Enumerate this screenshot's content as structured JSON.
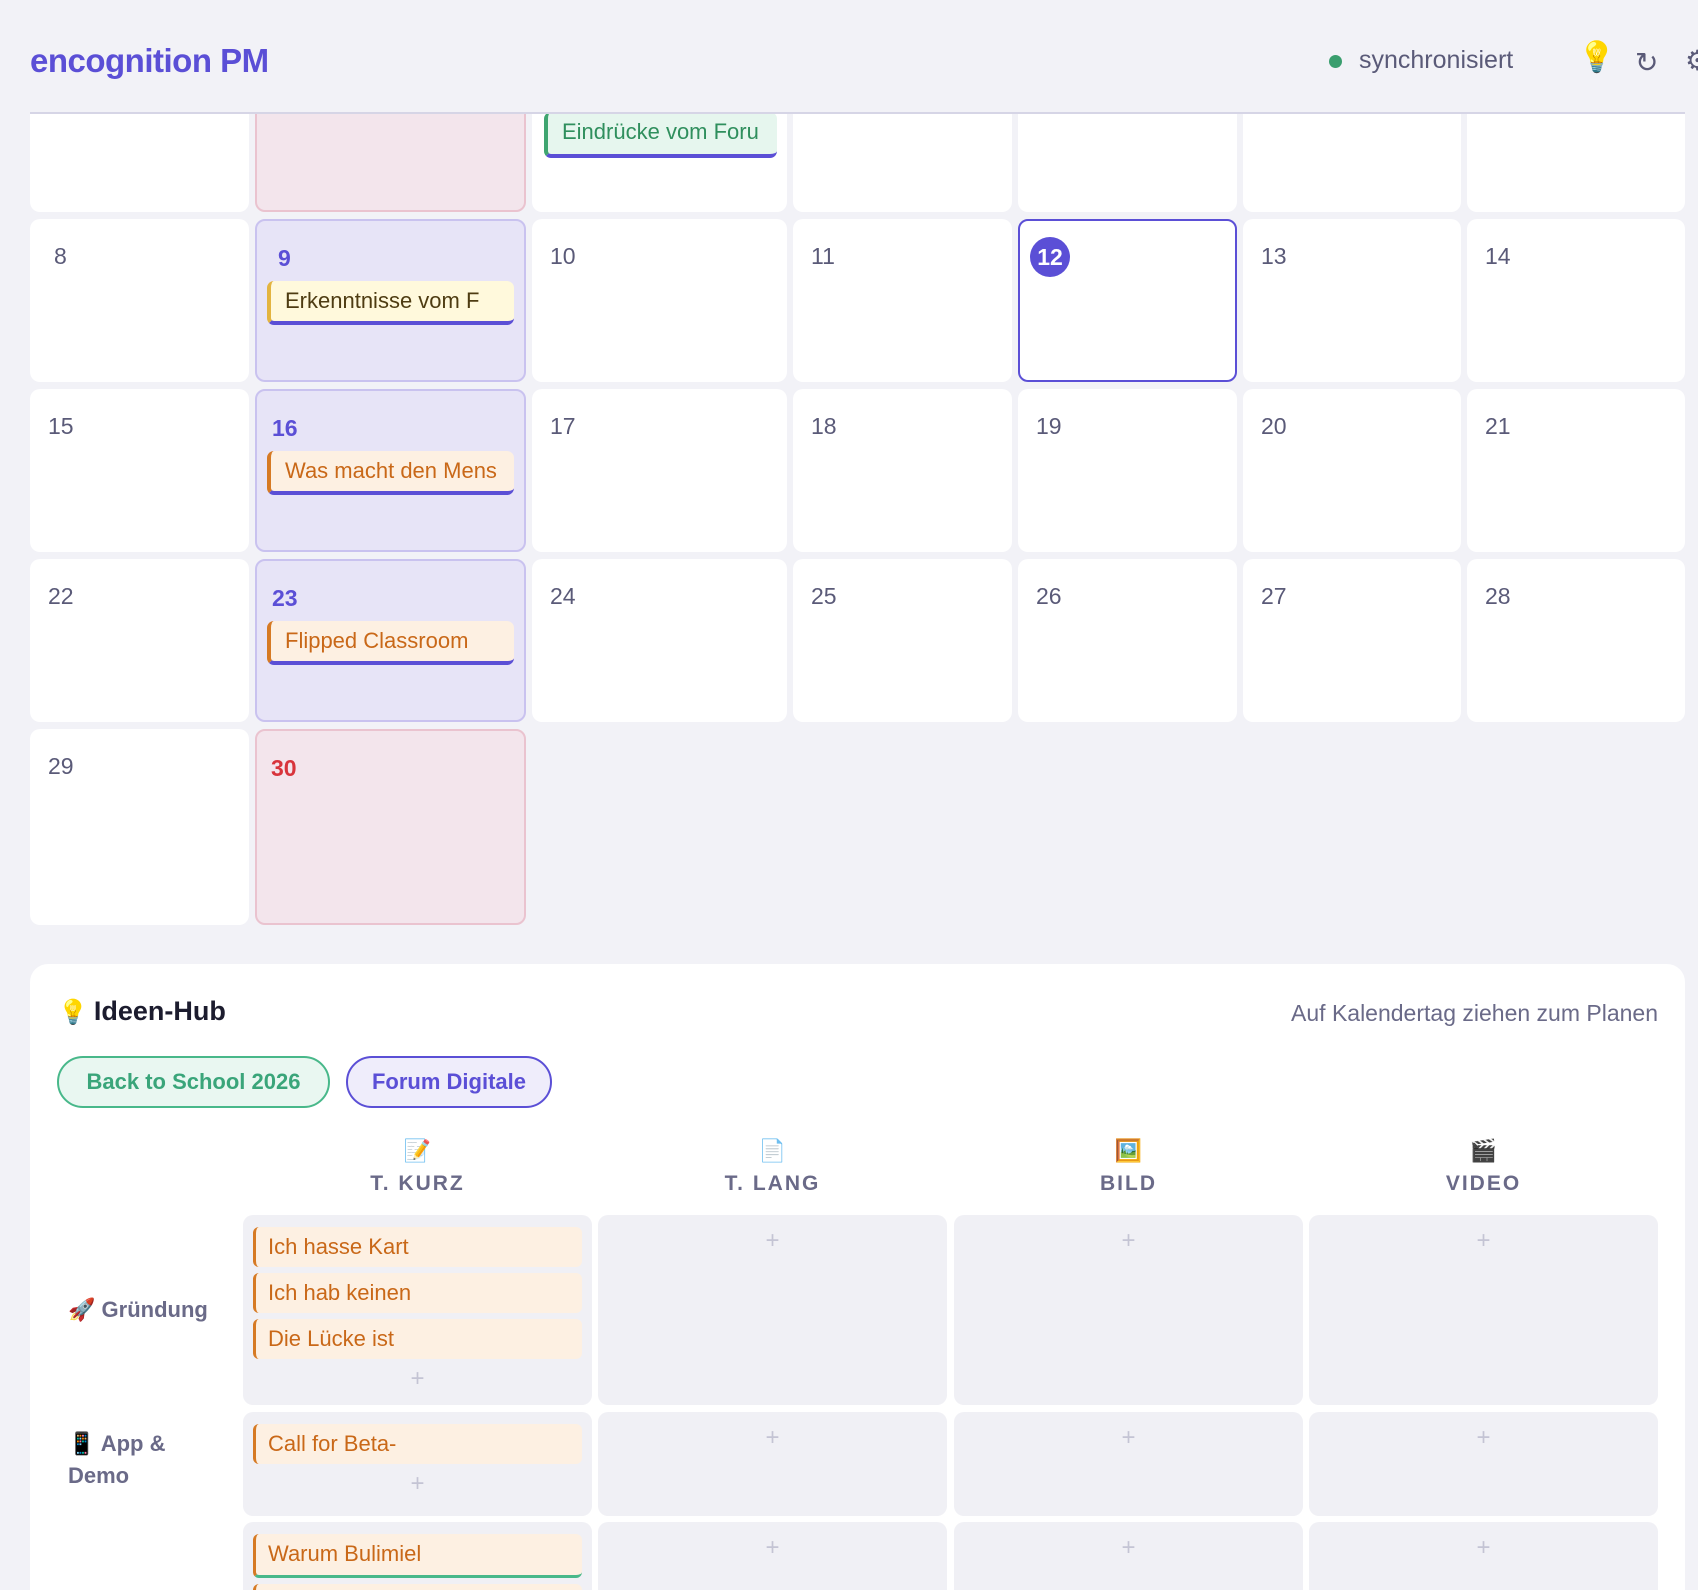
{
  "header": {
    "brand": "encognition PM",
    "sync_status": "synchronisiert",
    "icons": [
      "lightbulb-icon",
      "refresh-icon",
      "gear-icon"
    ]
  },
  "calendar": {
    "top_partial_event": "Eindrücke vom Foru",
    "days": {
      "d8": "8",
      "d9": "9",
      "d10": "10",
      "d11": "11",
      "d12": "12",
      "d13": "13",
      "d14": "14",
      "d15": "15",
      "d16": "16",
      "d17": "17",
      "d18": "18",
      "d19": "19",
      "d20": "20",
      "d21": "21",
      "d22": "22",
      "d23": "23",
      "d24": "24",
      "d25": "25",
      "d26": "26",
      "d27": "27",
      "d28": "28",
      "d29": "29",
      "d30": "30"
    },
    "events": {
      "d9": "Erkenntnisse vom F",
      "d16": "Was macht den Mens",
      "d23": "Flipped Classroom"
    }
  },
  "hub": {
    "title": "Ideen-Hub",
    "hint": "Auf Kalendertag ziehen zum Planen",
    "pills": [
      "Back to School 2026",
      "Forum Digitale"
    ],
    "columns": [
      {
        "icon": "📝",
        "label": "T. KURZ"
      },
      {
        "icon": "📄",
        "label": "T. LANG"
      },
      {
        "icon": "🖼️",
        "label": "BILD"
      },
      {
        "icon": "🎬",
        "label": "VIDEO"
      }
    ],
    "rows": [
      {
        "icon": "🚀",
        "label": "Gründung",
        "cards": [
          "Ich hasse Kart",
          "Ich hab keinen",
          "Die Lücke ist"
        ]
      },
      {
        "icon": "📱",
        "label": "App & Demo",
        "cards": [
          "Call for Beta-"
        ]
      },
      {
        "icon": "",
        "label": "",
        "cards": [
          "Warum Bulimiel"
        ]
      }
    ],
    "plus": "+"
  },
  "colors": {
    "accent": "#5b4fd6",
    "sync_green": "#3a9e6e",
    "holiday_red": "#d8343c",
    "event_orange": "#c96818"
  }
}
